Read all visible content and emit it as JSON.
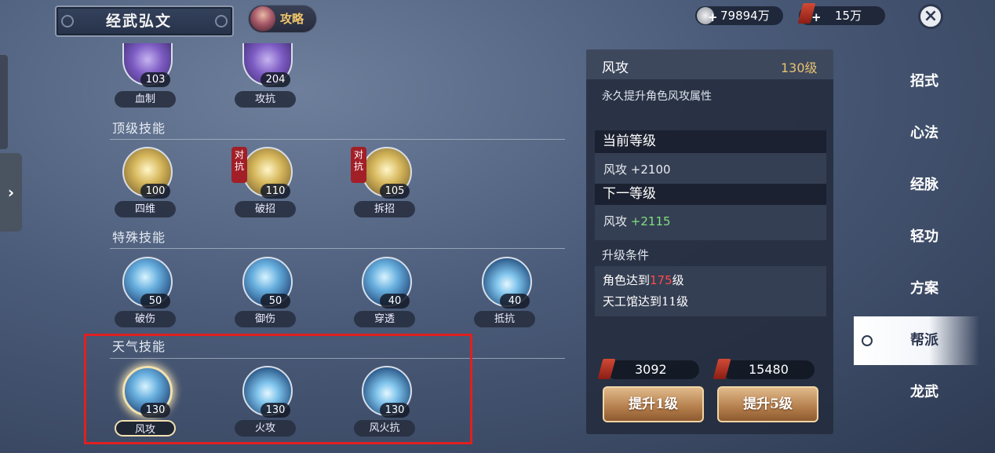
{
  "header": {
    "title": "经武弘文",
    "help": "?",
    "guide": "攻略",
    "currency1": {
      "plus": "+",
      "value": "79894万"
    },
    "currency2": {
      "plus": "+",
      "value": "15万"
    },
    "close": "×",
    "side_arrow": "›"
  },
  "sections": [
    {
      "title": "",
      "skills": [
        {
          "name": "血制",
          "level": "103"
        },
        {
          "name": "攻抗",
          "level": "204"
        }
      ]
    },
    {
      "title": "顶级技能",
      "skills": [
        {
          "name": "四维",
          "level": "100"
        },
        {
          "name": "破招",
          "level": "110",
          "tag": "对抗"
        },
        {
          "name": "拆招",
          "level": "105",
          "tag": "对抗"
        }
      ]
    },
    {
      "title": "特殊技能",
      "skills": [
        {
          "name": "破伤",
          "level": "50"
        },
        {
          "name": "御伤",
          "level": "50"
        },
        {
          "name": "穿透",
          "level": "40"
        },
        {
          "name": "抵抗",
          "level": "40"
        }
      ]
    },
    {
      "title": "天气技能",
      "skills": [
        {
          "name": "风攻",
          "level": "130",
          "selected": true
        },
        {
          "name": "火攻",
          "level": "130"
        },
        {
          "name": "风火抗",
          "level": "130"
        }
      ]
    }
  ],
  "detail": {
    "name": "风攻",
    "level": "130级",
    "desc": "永久提升角色风攻属性",
    "current_title": "当前等级",
    "current_stat": "风攻",
    "current_value": "+2100",
    "next_title": "下一等级",
    "next_stat": "风攻",
    "next_value": "+2115",
    "cond_title": "升级条件",
    "cond1_pre": "角色达到",
    "cond1_num": "175",
    "cond1_post": "级",
    "cond2": "天工馆达到11级",
    "cost1": "3092",
    "cost5": "15480",
    "btn1": "提升1级",
    "btn5": "提升5级"
  },
  "nav": [
    "招式",
    "心法",
    "经脉",
    "轻功",
    "方案",
    "帮派",
    "龙武"
  ],
  "nav_active": "帮派"
}
